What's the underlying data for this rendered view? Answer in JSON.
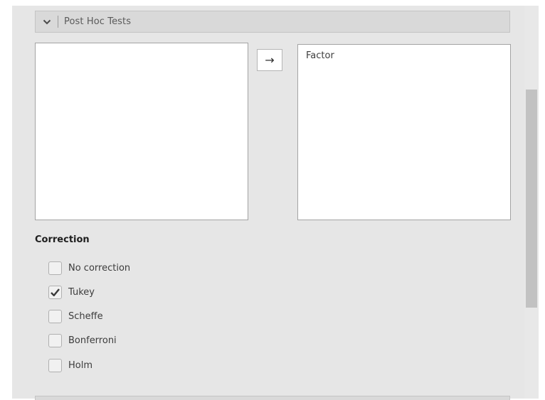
{
  "section": {
    "title": "Post Hoc Tests",
    "expanded": true
  },
  "available_list": {
    "items": []
  },
  "move_button": {
    "glyph": "→"
  },
  "target_list": {
    "items": [
      "Factor"
    ]
  },
  "correction": {
    "label": "Correction",
    "options": [
      {
        "label": "No correction",
        "checked": false
      },
      {
        "label": "Tukey",
        "checked": true
      },
      {
        "label": "Scheffe",
        "checked": false
      },
      {
        "label": "Bonferroni",
        "checked": false
      },
      {
        "label": "Holm",
        "checked": false
      }
    ]
  },
  "colors": {
    "panel_bg": "#e6e6e6",
    "header_bg": "#d9d9d9",
    "check": "#3a3a3a"
  }
}
